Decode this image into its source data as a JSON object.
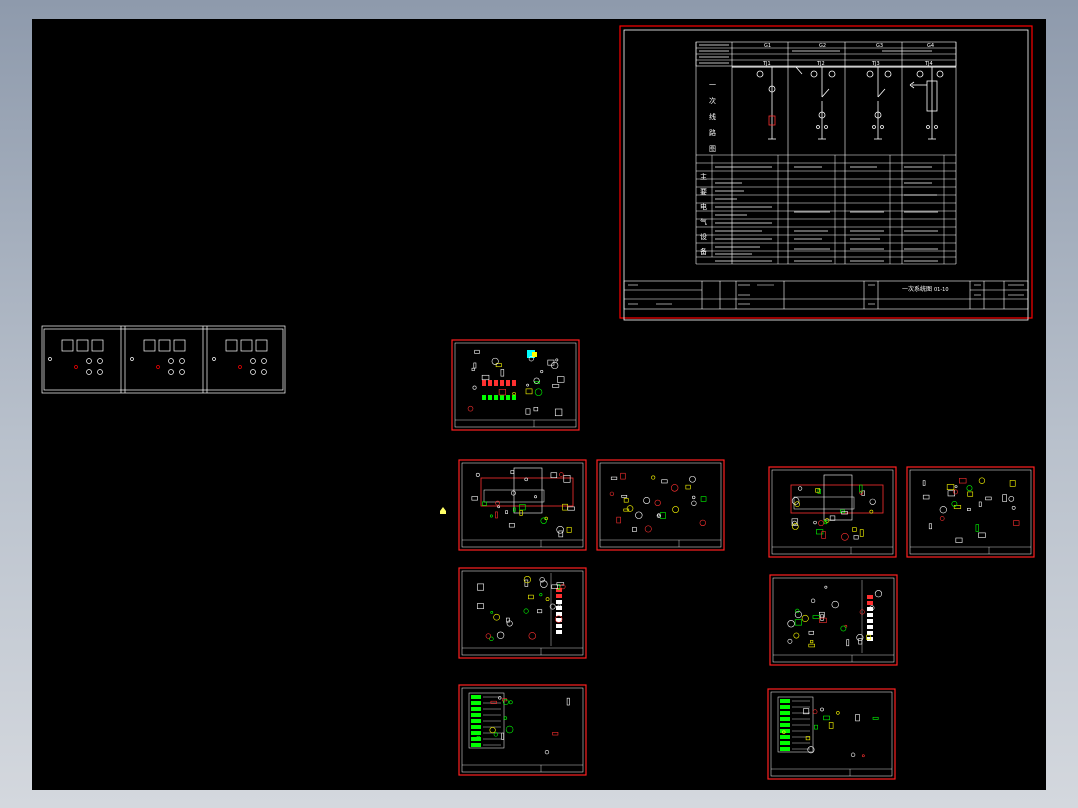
{
  "viewer": {
    "background": "#000000",
    "frame_color": "#ff0000",
    "line_color": "#ffffff",
    "accent_colors": [
      "#ff0000",
      "#00ff00",
      "#ffff00",
      "#00ffff",
      "#ff00ff"
    ]
  },
  "main_drawing": {
    "column_codes": [
      "G1",
      "G2",
      "G3",
      "G4"
    ],
    "switch_labels": [
      "TJ1",
      "TJ2",
      "TJ3",
      "TJ4"
    ],
    "vertical_label_1": [
      "一",
      "次",
      "线",
      "路",
      "图"
    ],
    "vertical_label_2": [
      "主",
      "要",
      "电",
      "气",
      "设",
      "备"
    ],
    "title_block": {
      "drawing_title": "一次系统图",
      "drawing_no": "01-10"
    }
  },
  "panel_strip": {
    "panel_count": 3
  },
  "sheets": {
    "count": 11
  }
}
